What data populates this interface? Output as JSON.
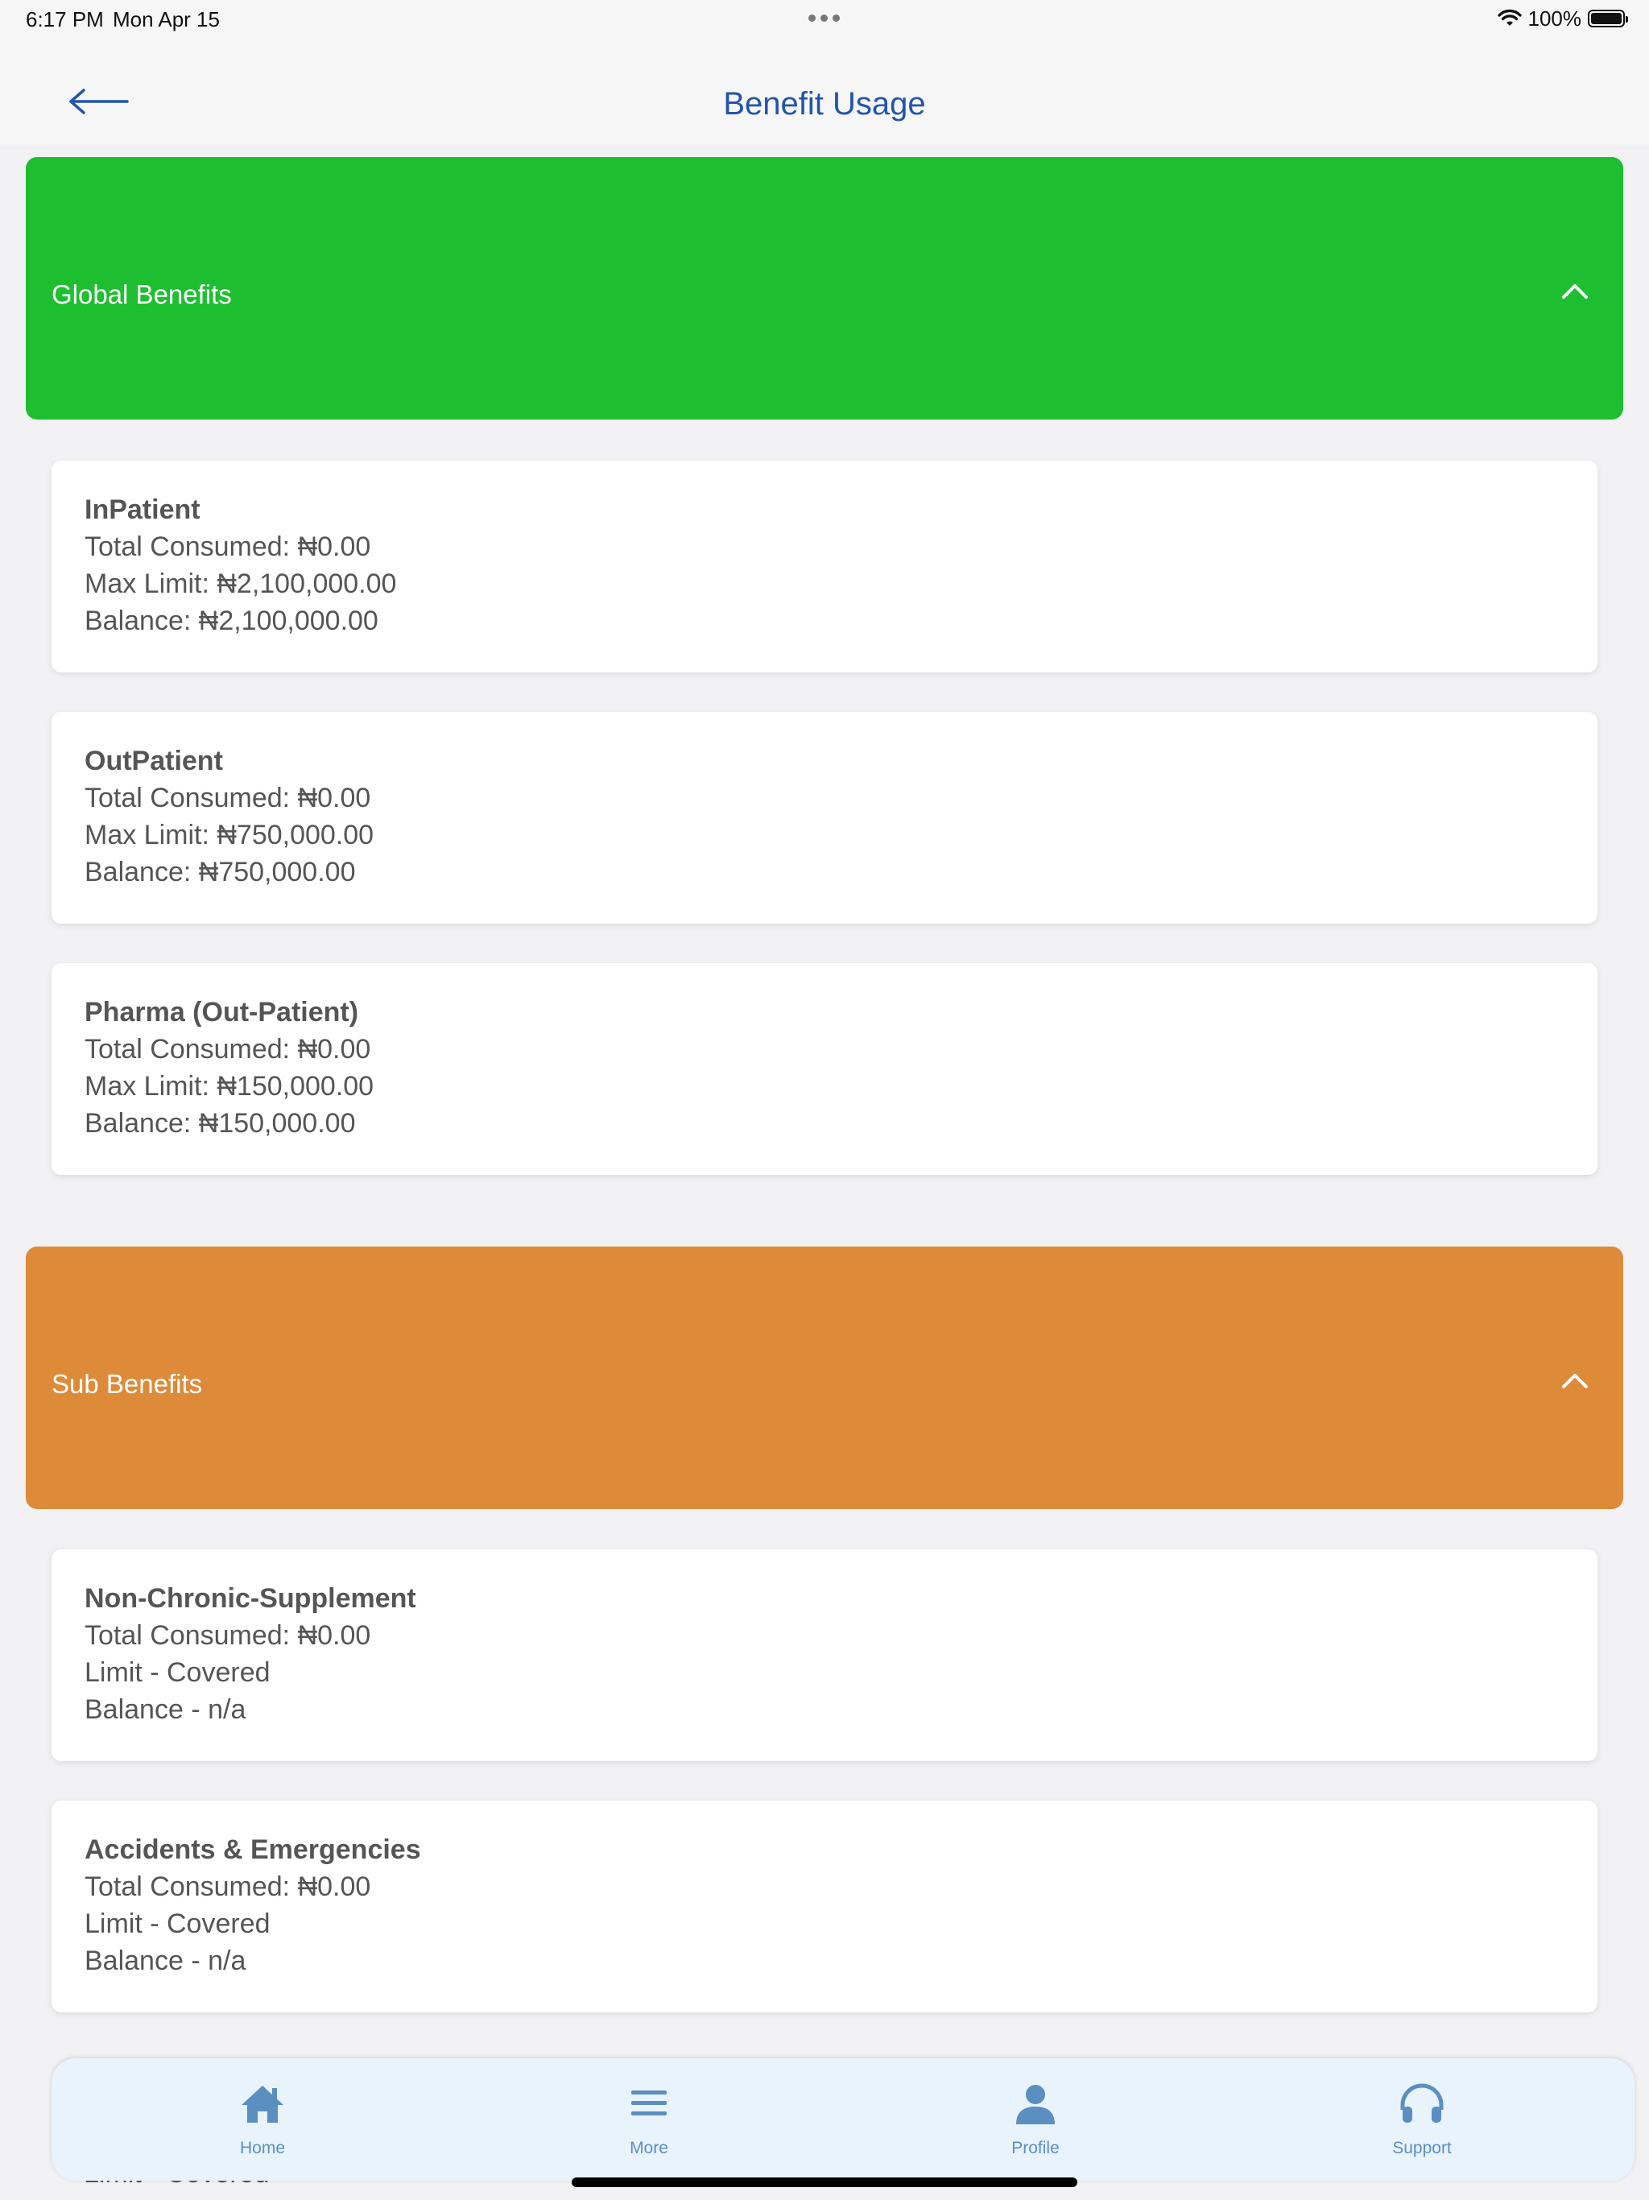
{
  "status_bar": {
    "time": "6:17 PM",
    "date": "Mon Apr 15",
    "battery": "100%"
  },
  "header": {
    "title": "Benefit Usage",
    "back_icon": "arrow-left-icon"
  },
  "global_benefits": {
    "title": "Global Benefits",
    "color": "#1dbf30",
    "items": [
      {
        "name": "InPatient",
        "line1": "Total Consumed: ₦0.00",
        "line2": "Max Limit: ₦2,100,000.00",
        "line3": "Balance: ₦2,100,000.00"
      },
      {
        "name": "OutPatient",
        "line1": "Total Consumed: ₦0.00",
        "line2": "Max Limit: ₦750,000.00",
        "line3": "Balance: ₦750,000.00"
      },
      {
        "name": "Pharma (Out-Patient)",
        "line1": "Total Consumed: ₦0.00",
        "line2": "Max Limit: ₦150,000.00",
        "line3": "Balance: ₦150,000.00"
      }
    ]
  },
  "sub_benefits": {
    "title": "Sub Benefits",
    "color": "#dd8a39",
    "items": [
      {
        "name": "Non-Chronic-Supplement",
        "line1": "Total Consumed: ₦0.00",
        "line2": "Limit - Covered",
        "line3": "Balance - n/a"
      },
      {
        "name": "Accidents & Emergencies",
        "line1": "Total Consumed: ₦0.00",
        "line2": "Limit - Covered",
        "line3": "Balance - n/a"
      }
    ],
    "partial_line": "Limit - Covered"
  },
  "tab_bar": {
    "tabs": [
      {
        "label": "Home",
        "icon": "home-icon"
      },
      {
        "label": "More",
        "icon": "menu-icon"
      },
      {
        "label": "Profile",
        "icon": "person-icon"
      },
      {
        "label": "Support",
        "icon": "headphones-icon"
      }
    ]
  }
}
